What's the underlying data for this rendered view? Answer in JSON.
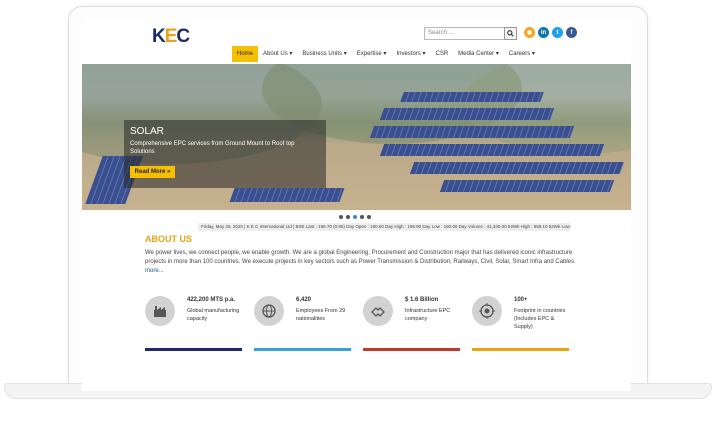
{
  "header": {
    "logo_pre": "K",
    "logo_mid": "E",
    "logo_post": "C",
    "search_placeholder": "Search ...",
    "social": [
      {
        "name": "rss-icon",
        "glyph": "◉",
        "color": "#f5a623"
      },
      {
        "name": "linkedin-icon",
        "glyph": "in",
        "color": "#0e76a8"
      },
      {
        "name": "twitter-icon",
        "glyph": "t",
        "color": "#1da1f2"
      },
      {
        "name": "facebook-icon",
        "glyph": "f",
        "color": "#3b5998"
      }
    ]
  },
  "nav": [
    {
      "label": "Home",
      "active": true
    },
    {
      "label": "About Us ▾",
      "active": false
    },
    {
      "label": "Business Units ▾",
      "active": false
    },
    {
      "label": "Expertise ▾",
      "active": false
    },
    {
      "label": "Investors ▾",
      "active": false
    },
    {
      "label": "CSR",
      "active": false
    },
    {
      "label": "Media Center ▾",
      "active": false
    },
    {
      "label": "Careers ▾",
      "active": false
    }
  ],
  "hero": {
    "title": "SOLAR",
    "subtitle": "Comprehensive EPC services from Ground Mount to Roof top Solutions",
    "button": "Read More »",
    "slide_count": 5,
    "active_slide": 3
  },
  "ticker": "Friday, May 29, 2020  |  K E C International Ltd  |  BSE  Last : 196.70 (0.85)  Day Open : 190.60  Day High : 196.90  Day Low : 190.60  Day Volume : 41,340.00  52Wk High : 558.10  52Wk Low : ",
  "about": {
    "title": "ABOUT US",
    "text": "We power lives, we connect people, we enable growth. We are a global Engineering, Procurement and Construction major that has delivered iconic infrastructure projects in more than 100 countries. We execute projects in key sectors such as Power Transmission & Distribution, Railways, Civil, Solar, Smart Infra and Cables.",
    "more": "more..."
  },
  "stats": [
    {
      "title": "422,200 MTS p.a.",
      "desc": "Global manufacturing capacity",
      "icon": "factory-icon",
      "bar_color": "#1c2a6b"
    },
    {
      "title": "6,420",
      "desc": "Employees From 29 nationalities",
      "icon": "globe-people-icon",
      "bar_color": "#3aa0d8"
    },
    {
      "title": "$ 1.6 Billion",
      "desc": "Infrastructure EPC company",
      "icon": "handshake-icon",
      "bar_color": "#c0392b"
    },
    {
      "title": "100+",
      "desc": "Footprint in countries (Includes EPC & Supply)",
      "icon": "target-icon",
      "bar_color": "#e8a317"
    }
  ]
}
